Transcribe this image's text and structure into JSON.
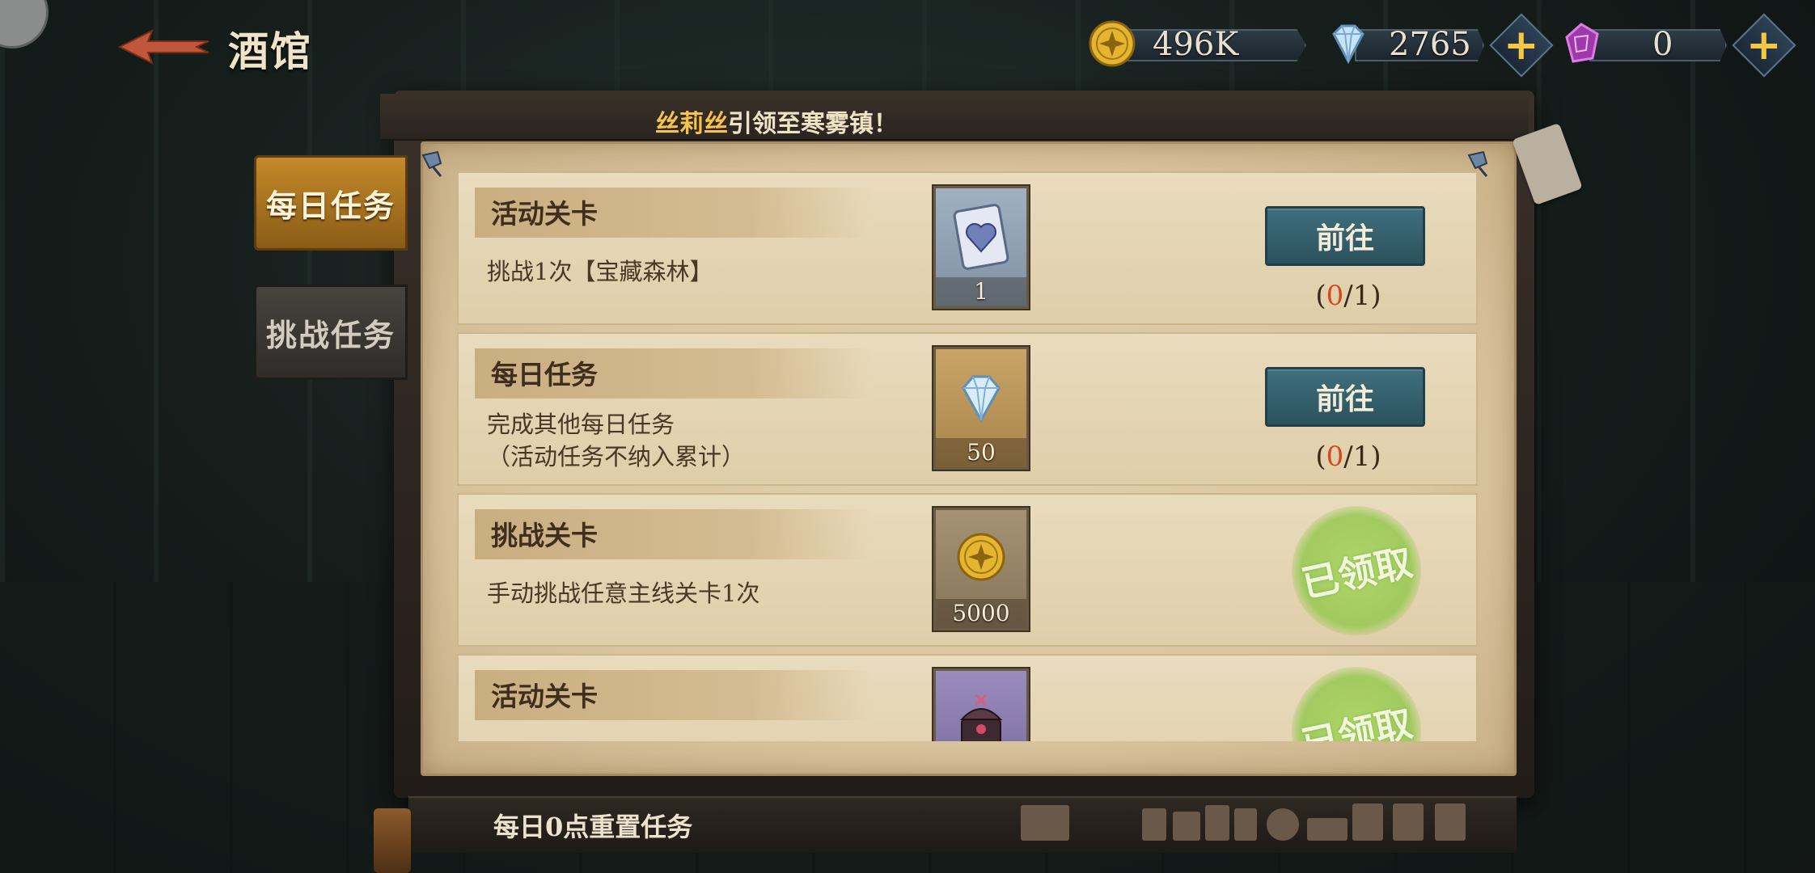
{
  "header": {
    "title": "酒馆"
  },
  "currencies": {
    "gold": {
      "value": "496K",
      "icon": "gold-coin-icon"
    },
    "diamond": {
      "value": "2765",
      "icon": "diamond-icon",
      "add": "+"
    },
    "crystal": {
      "value": "0",
      "icon": "purple-crystal-icon",
      "add": "+"
    }
  },
  "banner": {
    "highlight": "丝莉丝",
    "text": "引领至寒雾镇！"
  },
  "tabs": [
    {
      "label": "每日任务",
      "active": true
    },
    {
      "label": "挑战任务",
      "active": false
    }
  ],
  "tasks": [
    {
      "name": "活动关卡",
      "desc": "挑战1次【宝藏森林】",
      "reward": {
        "icon": "heart-card-icon",
        "count": "1",
        "color": "#8a9fb2"
      },
      "action": "前往",
      "progress": {
        "open": "(",
        "current": "0",
        "sep": "/",
        "total": "1",
        "close": ")"
      },
      "claimed": false
    },
    {
      "name": "每日任务",
      "desc": "完成其他每日任务\n（活动任务不纳入累计）",
      "reward": {
        "icon": "diamond-icon",
        "count": "50",
        "color": "#b49058"
      },
      "action": "前往",
      "progress": {
        "open": "(",
        "current": "0",
        "sep": "/",
        "total": "1",
        "close": ")"
      },
      "claimed": false
    },
    {
      "name": "挑战关卡",
      "desc": "手动挑战任意主线关卡1次",
      "reward": {
        "icon": "gold-coin-icon",
        "count": "5000",
        "color": "#8c7a5c"
      },
      "stamp": "已领取",
      "claimed": true
    },
    {
      "name": "活动关卡",
      "desc": "",
      "reward": {
        "icon": "treasure-chest-icon",
        "count": "",
        "color": "#8678a6"
      },
      "stamp": "已领取",
      "claimed": true
    }
  ],
  "footer": {
    "text": "每日0点重置任务"
  },
  "colors": {
    "accent_gold": "#f5c24a",
    "button_teal": "#3f6f7d",
    "progress_red": "#d8481e",
    "stamp_green": "#a8d660"
  }
}
